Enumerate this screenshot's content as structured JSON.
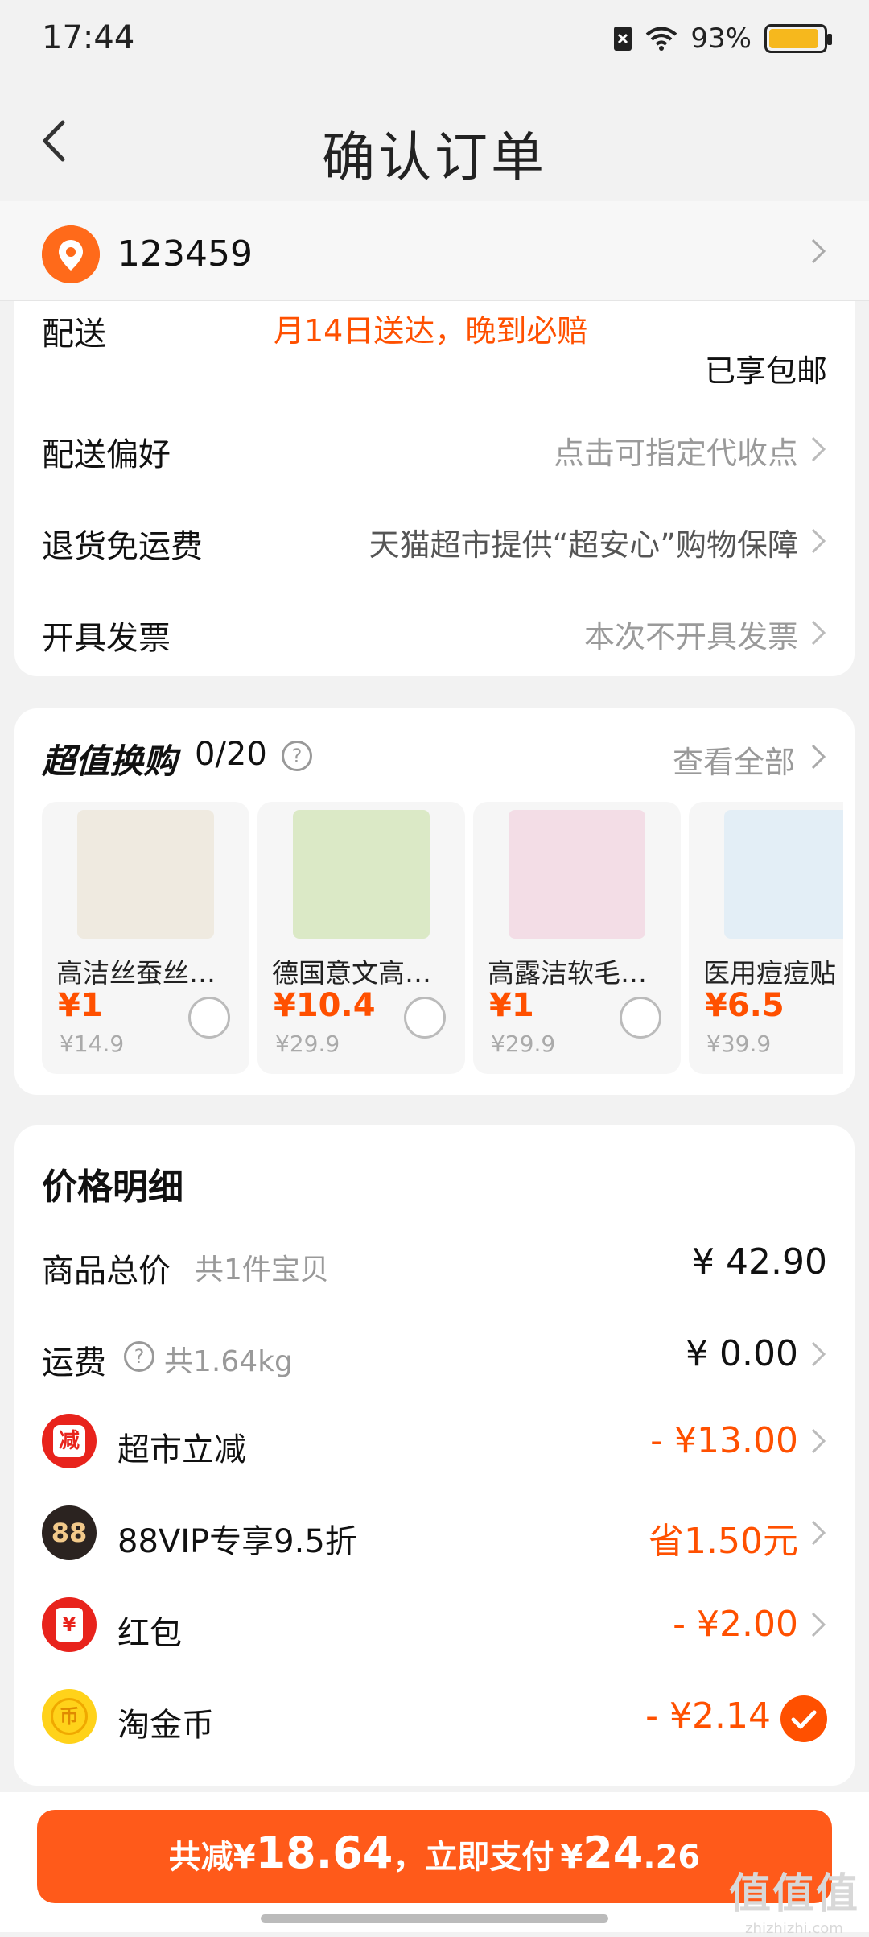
{
  "status": {
    "time": "17:44",
    "battery": "93%",
    "battery_level": 0.93
  },
  "nav": {
    "title": "确认订单"
  },
  "address": {
    "text": "123459"
  },
  "delivery": {
    "ship_label": "配送",
    "ship_value": "月14日送达，晚到必赔",
    "free_shipping": "已享包邮",
    "pref_label": "配送偏好",
    "pref_value": "点击可指定代收点",
    "return_label": "退货免运费",
    "return_value": "天猫超市提供“超安心”购物保障",
    "invoice_label": "开具发票",
    "invoice_value": "本次不开具发票"
  },
  "swap": {
    "title": "超值换购",
    "count": "0/20",
    "help": "?",
    "more": "查看全部",
    "products": [
      {
        "name": "高洁丝蚕丝…",
        "price": "¥1",
        "original": "¥14.9",
        "img_color": "#efeae0"
      },
      {
        "name": "德国意文高…",
        "price": "¥10.4",
        "original": "¥29.9",
        "img_color": "#dbe9c6"
      },
      {
        "name": "高露洁软毛…",
        "price": "¥1",
        "original": "¥29.9",
        "img_color": "#f3dde6"
      },
      {
        "name": "医用痘痘贴",
        "price": "¥6.5",
        "original": "¥39.9",
        "img_color": "#e3eef6"
      }
    ]
  },
  "price": {
    "title": "价格明细",
    "goods_label": "商品总价",
    "goods_sub": "共1件宝贝",
    "goods_value": "¥ 42.90",
    "freight_label": "运费",
    "freight_help": "?",
    "freight_sub": "共1.64kg",
    "freight_value": "¥ 0.00",
    "market_label": "超市立减",
    "market_badge": "减",
    "market_value": "- ¥13.00",
    "vip_label": "88VIP专享9.5折",
    "vip_badge": "88",
    "vip_value": "省1.50元",
    "redpack_label": "红包",
    "redpack_badge": "¥",
    "redpack_value": "- ¥2.00",
    "coin_label": "淘金币",
    "coin_badge": "币",
    "coin_value": "- ¥2.14"
  },
  "pay": {
    "prefix": "共减",
    "reduce_currency": "¥",
    "reduce_amount": "18.64",
    "middle": "，立即支付",
    "pay_currency": "¥",
    "pay_amount": "24",
    "pay_decimal": ".26"
  },
  "watermark": {
    "main": "值值值",
    "sub": "zhizhizhi.com"
  },
  "colors": {
    "accent": "#ff5000",
    "button": "#ff5a1a"
  }
}
